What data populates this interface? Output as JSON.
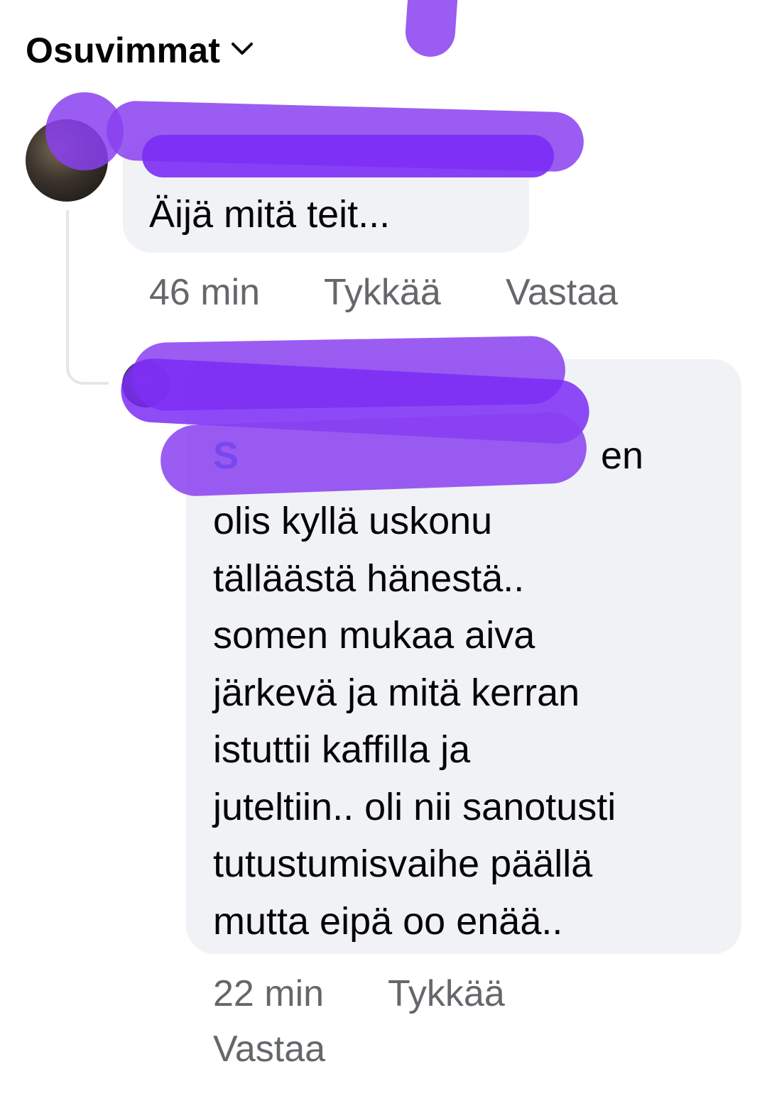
{
  "sort": {
    "label": "Osuvimmat",
    "icon": "chevron-down-icon"
  },
  "comments": [
    {
      "text": "Äijä mitä teit...",
      "time": "46 min",
      "like_label": "Tykkää",
      "reply_label": "Vastaa"
    },
    {
      "first_line_tail": "en",
      "lines": [
        "olis kyllä uskonu",
        "tälläästä hänestä..",
        "somen mukaa aiva",
        "järkevä ja mitä kerran",
        "istuttii kaffilla ja",
        "juteltiin.. oli nii sanotusti",
        "tutustumisvaihe päällä",
        "mutta eipä oo enää.."
      ],
      "time": "22 min",
      "like_label": "Tykkää",
      "reply_label": "Vastaa"
    }
  ],
  "colors": {
    "bubble": "#f0f2f5",
    "meta_text": "#65676b",
    "mention": "#1b74e4",
    "redaction": "#8a3ff0"
  }
}
